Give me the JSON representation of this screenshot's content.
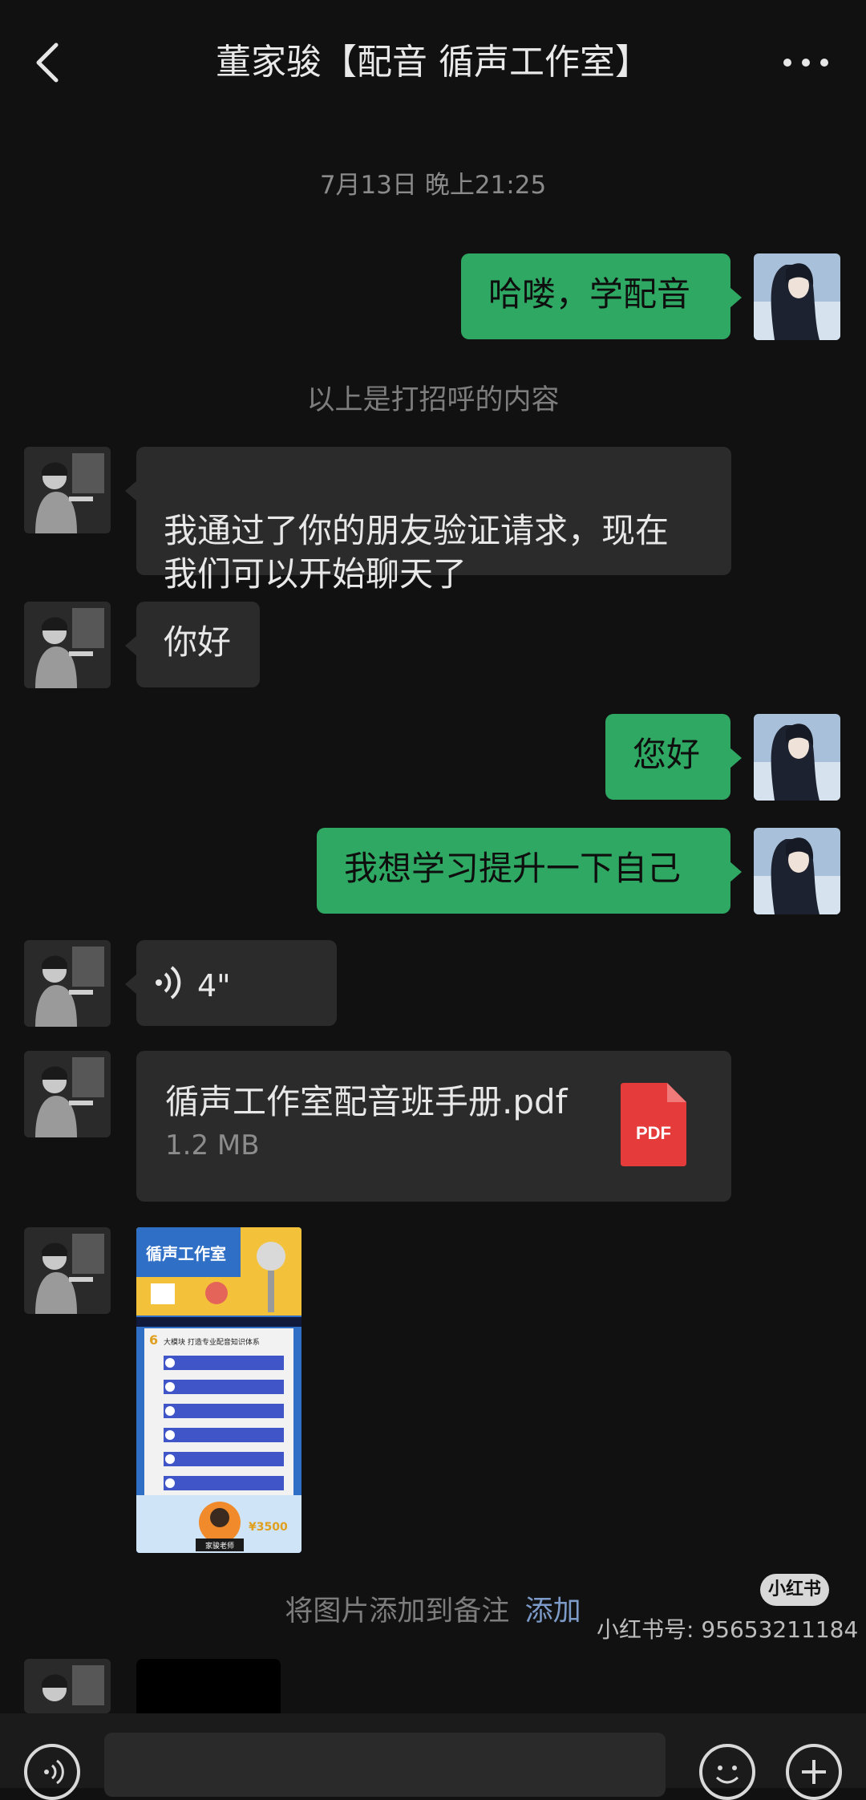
{
  "header": {
    "title": "董家骏【配音 循声工作室】"
  },
  "timestamp": "7月13日 晚上21:25",
  "messages": {
    "m1": "哈喽，学配音",
    "m2": "我通过了你的朋友验证请求，现在\n我们可以开始聊天了",
    "m3": "你好",
    "m4": "您好",
    "m5": "我想学习提升一下自己",
    "voice_duration": "4\"",
    "file_name": "循声工作室配音班手册.pdf",
    "file_size": "1.2 MB",
    "file_type_label": "PDF"
  },
  "system": {
    "greeting_notice": "以上是打招呼的内容",
    "add_image_prefix": "将图片添加到备注",
    "add_image_link": "添加"
  },
  "image_thumb": {
    "title": "循声工作室",
    "headline_number": "6",
    "headline": "大模块 打造专业配音知识体系",
    "price": "¥3500",
    "teacher": "家骏老师"
  },
  "watermark": {
    "badge": "小红书",
    "text": "小红书号: 95653211184"
  },
  "colors": {
    "sent_bubble": "#2ea862",
    "recv_bubble": "#2b2b2b",
    "background": "#111111",
    "link": "#7d9bc8"
  }
}
